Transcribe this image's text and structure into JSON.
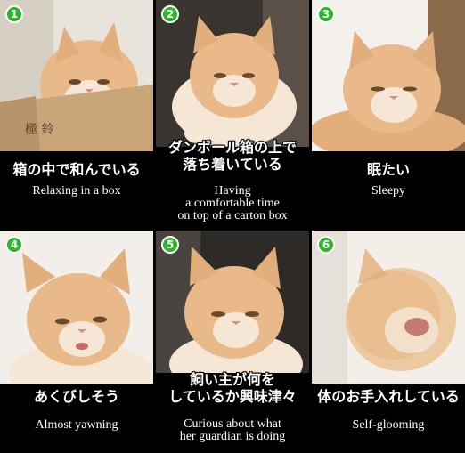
{
  "panels": [
    {
      "number": "1",
      "caption_ja": "箱の中で和んでいる",
      "caption_en": "Relaxing in a box",
      "box_text": "極 鈴"
    },
    {
      "number": "2",
      "caption_ja": "ダンボール箱の上で\n落ち着いている",
      "caption_en": "Having\na comfortable time\non top of a carton box"
    },
    {
      "number": "3",
      "caption_ja": "眠たい",
      "caption_en": "Sleepy"
    },
    {
      "number": "4",
      "caption_ja": "あくびしそう",
      "caption_en": "Almost yawning"
    },
    {
      "number": "5",
      "caption_ja": "飼い主が何を\nしているか興味津々",
      "caption_en": "Curious about what\nher guardian is doing"
    },
    {
      "number": "6",
      "caption_ja": "体のお手入れしている",
      "caption_en": "Self-glooming"
    }
  ],
  "colors": {
    "badge": "#2bb52b",
    "fur": "#e9b98a",
    "fur_light": "#f5e6d6",
    "background": "#000000",
    "box": "#c9a57a"
  }
}
